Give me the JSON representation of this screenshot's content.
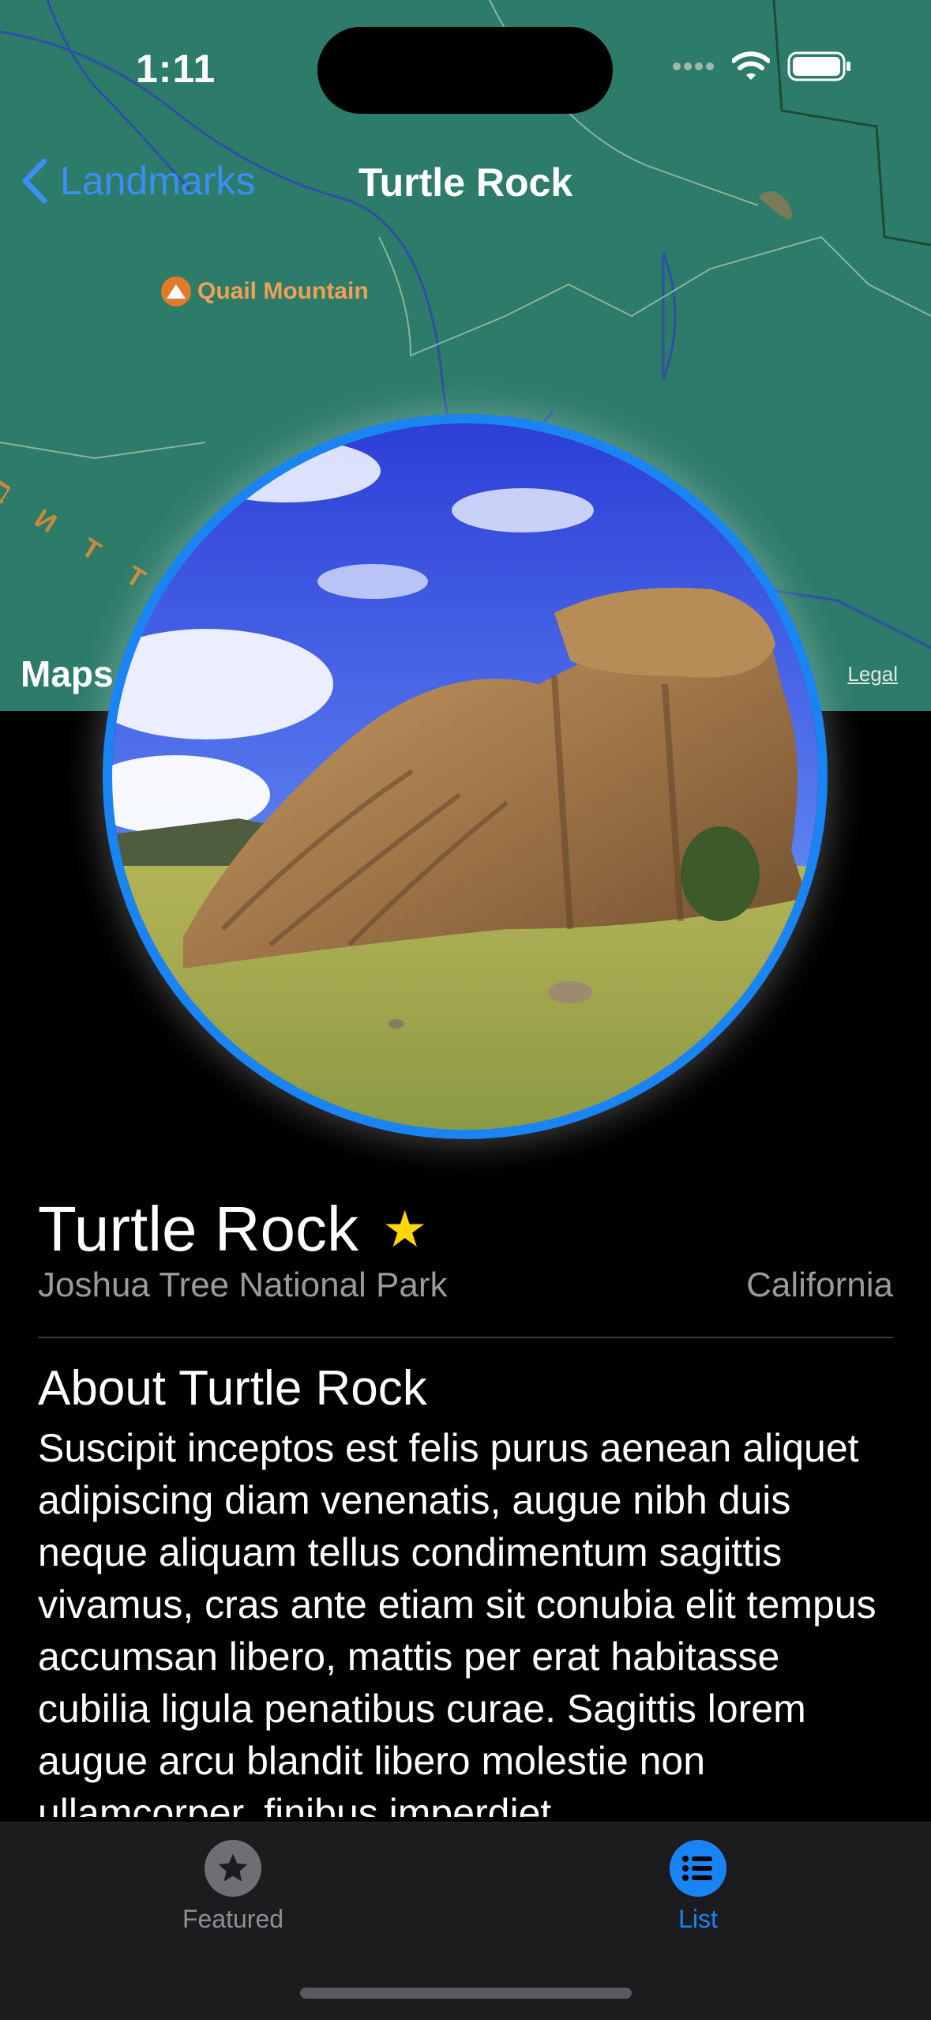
{
  "status": {
    "time": "1:11"
  },
  "nav": {
    "back_label": "Landmarks",
    "title": "Turtle Rock"
  },
  "map": {
    "poi_label": "Quail Mountain",
    "trail_label": "ℶ И Т Т Л",
    "maps_logo": "Maps",
    "legal_label": "Legal"
  },
  "landmark": {
    "name": "Turtle Rock",
    "favorite": true,
    "park": "Joshua Tree National Park",
    "state": "California",
    "about_title": "About Turtle Rock",
    "description": "Suscipit inceptos est felis purus aenean aliquet adipiscing diam venenatis, augue nibh duis neque aliquam tellus condimentum sagittis vivamus, cras ante etiam sit conubia elit tempus accumsan libero, mattis per erat habitasse cubilia ligula penatibus curae. Sagittis lorem augue arcu blandit libero molestie non ullamcorper, finibus imperdiet"
  },
  "tabs": [
    {
      "label": "Featured",
      "icon": "star-circle-icon",
      "selected": false
    },
    {
      "label": "List",
      "icon": "list-bullet-circle-icon",
      "selected": true
    }
  ],
  "colors": {
    "accent": "#1b84f5",
    "star": "#ffd60a",
    "map": "#2c7a68"
  }
}
